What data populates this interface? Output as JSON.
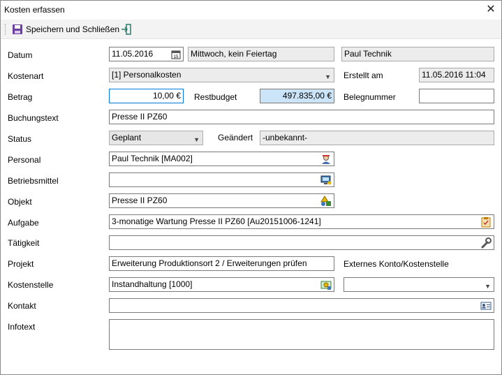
{
  "window": {
    "title": "Kosten erfassen"
  },
  "toolbar": {
    "save_label": "Speichern und Schließen"
  },
  "labels": {
    "datum": "Datum",
    "kostenart": "Kostenart",
    "betrag": "Betrag",
    "buchungstext": "Buchungstext",
    "status": "Status",
    "personal": "Personal",
    "betriebsmittel": "Betriebsmittel",
    "objekt": "Objekt",
    "aufgabe": "Aufgabe",
    "taetigkeit": "Tätigkeit",
    "projekt": "Projekt",
    "kostenstelle": "Kostenstelle",
    "kontakt": "Kontakt",
    "infotext": "Infotext",
    "erstellt_am": "Erstellt am",
    "restbudget": "Restbudget",
    "belegnummer": "Belegnummer",
    "geaendert": "Geändert",
    "externes_konto": "Externes Konto/Kostenstelle"
  },
  "values": {
    "datum": "11.05.2016",
    "wochentag": "Mittwoch, kein Feiertag",
    "benutzer": "Paul Technik",
    "kostenart": "[1] Personalkosten",
    "erstellt_am": "11.05.2016 11:04",
    "betrag": "10,00 €",
    "restbudget": "497.835,00 €",
    "belegnummer": "",
    "buchungstext": "Presse II PZ60",
    "status": "Geplant",
    "geaendert": "-unbekannt-",
    "personal": "Paul Technik [MA002]",
    "betriebsmittel": "",
    "objekt": "Presse II PZ60",
    "aufgabe": "3-monatige Wartung Presse II PZ60 [Au20151006-1241]",
    "taetigkeit": "",
    "projekt": "Erweiterung Produktionsort 2 / Erweiterungen prüfen",
    "kostenstelle": "Instandhaltung [1000]",
    "externes_konto": "",
    "kontakt": "",
    "infotext": ""
  },
  "icons": {
    "close": "close-icon",
    "save": "floppy-disk-icon",
    "exit": "exit-door-icon",
    "calendar": "calendar-icon",
    "personal": "person-picker-icon",
    "betriebsmittel": "equipment-picker-icon",
    "objekt": "object-shapes-icon",
    "aufgabe": "clipboard-task-icon",
    "taetigkeit": "wrench-icon",
    "kostenstelle": "cost-center-icon",
    "kontakt": "contact-card-icon"
  }
}
